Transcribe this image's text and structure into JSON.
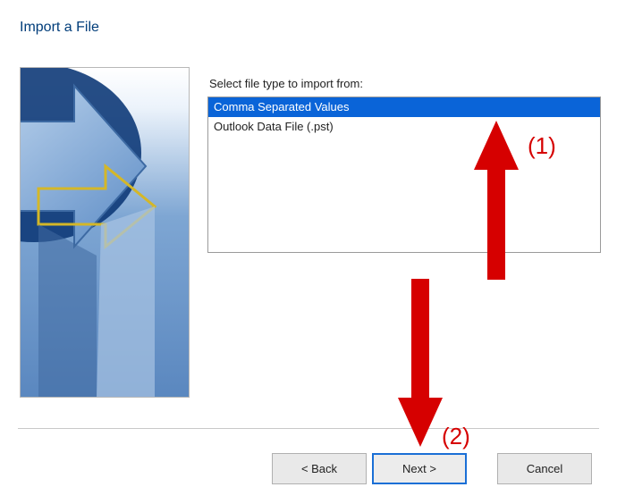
{
  "title": "Import a File",
  "selectLabel": "Select file type to import from:",
  "fileTypes": [
    {
      "label": "Comma Separated Values",
      "selected": true
    },
    {
      "label": "Outlook Data File (.pst)",
      "selected": false
    }
  ],
  "buttons": {
    "back": "< Back",
    "next": "Next >",
    "cancel": "Cancel"
  },
  "annotations": {
    "one": "(1)",
    "two": "(2)",
    "color": "#d60000"
  }
}
